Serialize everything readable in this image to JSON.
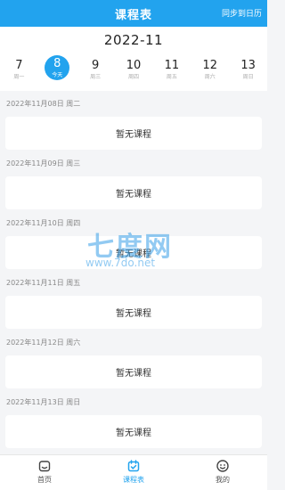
{
  "header": {
    "title": "课程表",
    "sync_label": "同步到日历",
    "bg_color": "#22a3ee"
  },
  "calendar": {
    "month": "2022-11",
    "days": [
      {
        "num": "7",
        "label": "周一",
        "active": false
      },
      {
        "num": "8",
        "label": "今天",
        "active": true
      },
      {
        "num": "9",
        "label": "周三",
        "active": false
      },
      {
        "num": "10",
        "label": "周四",
        "active": false
      },
      {
        "num": "11",
        "label": "周五",
        "active": false
      },
      {
        "num": "12",
        "label": "周六",
        "active": false
      },
      {
        "num": "13",
        "label": "周日",
        "active": false
      }
    ]
  },
  "schedule": [
    {
      "date": "2022年11月08日 周二",
      "status": "暂无课程"
    },
    {
      "date": "2022年11月09日 周三",
      "status": "暂无课程"
    },
    {
      "date": "2022年11月10日 周四",
      "status": "暂无课程"
    },
    {
      "date": "2022年11月11日 周五",
      "status": "暂无课程"
    },
    {
      "date": "2022年11月12日 周六",
      "status": "暂无课程"
    },
    {
      "date": "2022年11月13日 周日",
      "status": "暂无课程"
    }
  ],
  "watermark": {
    "brand": "七度网",
    "url": "www.7do.net"
  },
  "tabbar": {
    "tabs": [
      {
        "label": "首页",
        "icon": "home-icon",
        "active": false
      },
      {
        "label": "课程表",
        "icon": "calendar-icon",
        "active": true
      },
      {
        "label": "我的",
        "icon": "smiley-icon",
        "active": false
      }
    ]
  }
}
